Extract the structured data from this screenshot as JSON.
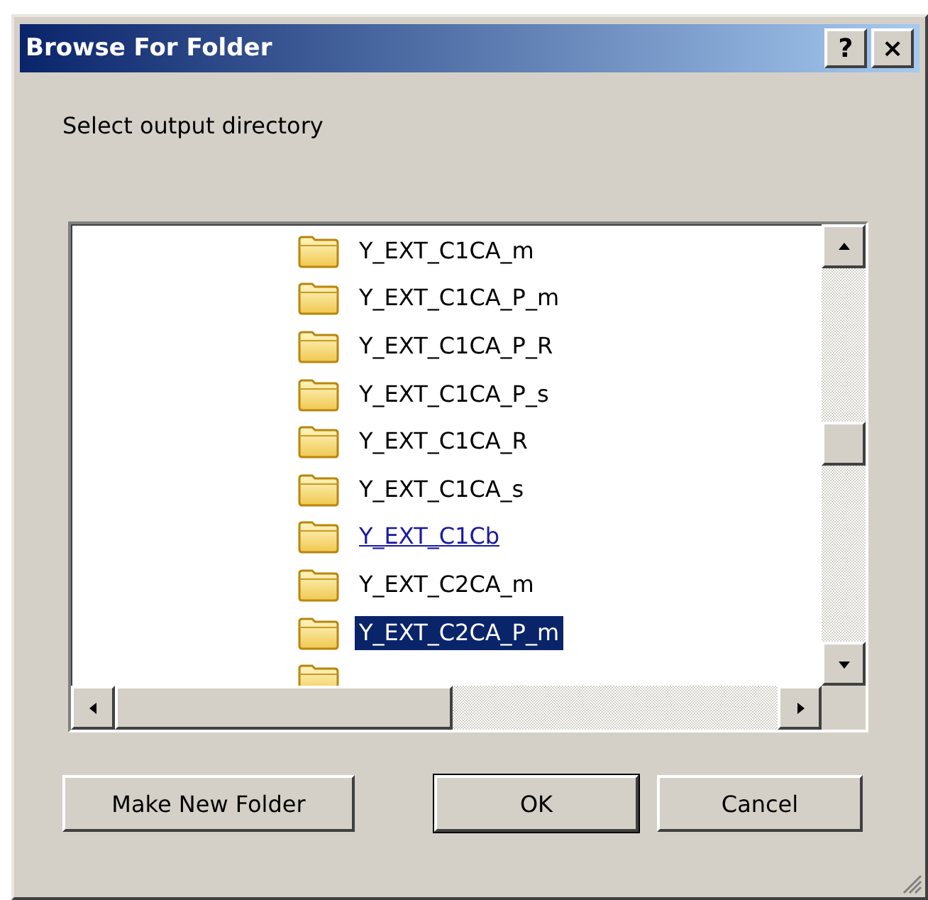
{
  "window": {
    "title": "Browse For Folder",
    "help_button": "?",
    "close_button": "×"
  },
  "prompt": "Select output directory",
  "folders": [
    {
      "name": "Y_EXT_C1CA_m",
      "selected": false,
      "hot": false
    },
    {
      "name": "Y_EXT_C1CA_P_m",
      "selected": false,
      "hot": false
    },
    {
      "name": "Y_EXT_C1CA_P_R",
      "selected": false,
      "hot": false
    },
    {
      "name": "Y_EXT_C1CA_P_s",
      "selected": false,
      "hot": false
    },
    {
      "name": "Y_EXT_C1CA_R",
      "selected": false,
      "hot": false
    },
    {
      "name": "Y_EXT_C1CA_s",
      "selected": false,
      "hot": false
    },
    {
      "name": "Y_EXT_C1Cb",
      "selected": false,
      "hot": true
    },
    {
      "name": "Y_EXT_C2CA_m",
      "selected": false,
      "hot": false
    },
    {
      "name": "Y_EXT_C2CA_P_m",
      "selected": true,
      "hot": false
    }
  ],
  "buttons": [
    {
      "label": "Make New Folder",
      "default": false
    },
    {
      "label": "OK",
      "default": true
    },
    {
      "label": "Cancel",
      "default": false
    }
  ]
}
